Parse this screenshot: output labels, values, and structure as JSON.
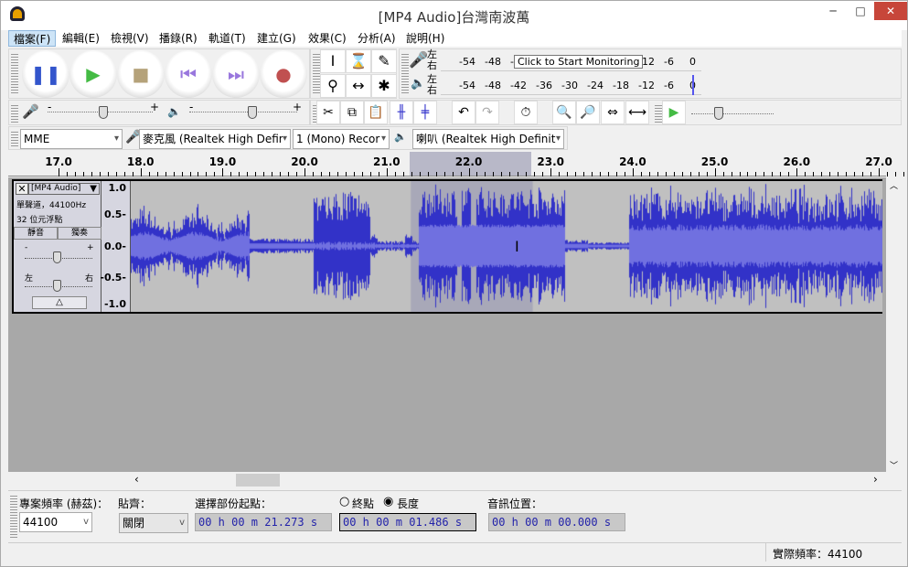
{
  "window": {
    "title": "[MP4 Audio]台灣南波萬",
    "minimize": "─",
    "maximize": "□",
    "close": "✕"
  },
  "menu": [
    "檔案(F)",
    "編輯(E)",
    "檢視(V)",
    "播錄(R)",
    "軌道(T)",
    "建立(G)",
    "效果(C)",
    "分析(A)",
    "說明(H)"
  ],
  "transport": [
    {
      "name": "pause",
      "glyph": "❚❚",
      "color": "#3355cc"
    },
    {
      "name": "play",
      "glyph": "▶",
      "color": "#44bb44"
    },
    {
      "name": "stop",
      "glyph": "■",
      "color": "#b5a27a"
    },
    {
      "name": "skip-start",
      "glyph": "⏮",
      "color": "#9977dd"
    },
    {
      "name": "skip-end",
      "glyph": "⏭",
      "color": "#9977dd"
    },
    {
      "name": "record",
      "glyph": "●",
      "color": "#c05050"
    }
  ],
  "tools": [
    "I",
    "⌛",
    "✎",
    "⚲",
    "↔",
    "✱"
  ],
  "meters": {
    "record_l": "左",
    "record_r": "右",
    "play_l": "左",
    "play_r": "右",
    "ticks": [
      "-54",
      "-48",
      "-42",
      "-36",
      "-30",
      "-24",
      "-18",
      "-12",
      "-6",
      "0"
    ],
    "tooltip": "Click to Start Monitoring"
  },
  "mixer": {
    "minus": "-",
    "plus": "+"
  },
  "devices": {
    "host": "MME",
    "input": "麥克風 (Realtek High Defin",
    "channels": "1 (Mono) Recor",
    "output": "喇叭 (Realtek High Definiti"
  },
  "ruler": [
    "17.0",
    "18.0",
    "19.0",
    "20.0",
    "21.0",
    "22.0",
    "23.0",
    "24.0",
    "25.0",
    "26.0",
    "27.0"
  ],
  "track": {
    "name": "[MP4 Audio]",
    "info1": "單聲道，44100Hz",
    "info2": "32 位元浮點",
    "mute": "靜音",
    "solo": "獨奏",
    "gain_minus": "-",
    "gain_plus": "+",
    "pan_left": "左",
    "pan_right": "右",
    "scale": [
      "1.0",
      "0.5-",
      "0.0-",
      "-0.5-",
      "-1.0"
    ],
    "wave_color": "#3232c8",
    "selection": [
      21.273,
      22.759
    ]
  },
  "selection_bar": {
    "rate_label": "專案頻率 (赫茲)：",
    "rate": "44100",
    "snap_label": "貼齊：",
    "snap": "關閉",
    "start_label": "選擇部份起點：",
    "end_label": "終點",
    "length_label": "長度",
    "length_selected": true,
    "start": "00 h 00 m 21.273 s",
    "length": "00 h 00 m 01.486 s",
    "pos_label": "音訊位置：",
    "position": "00 h 00 m 00.000 s"
  },
  "status": {
    "rate": "實際頻率：44100"
  }
}
